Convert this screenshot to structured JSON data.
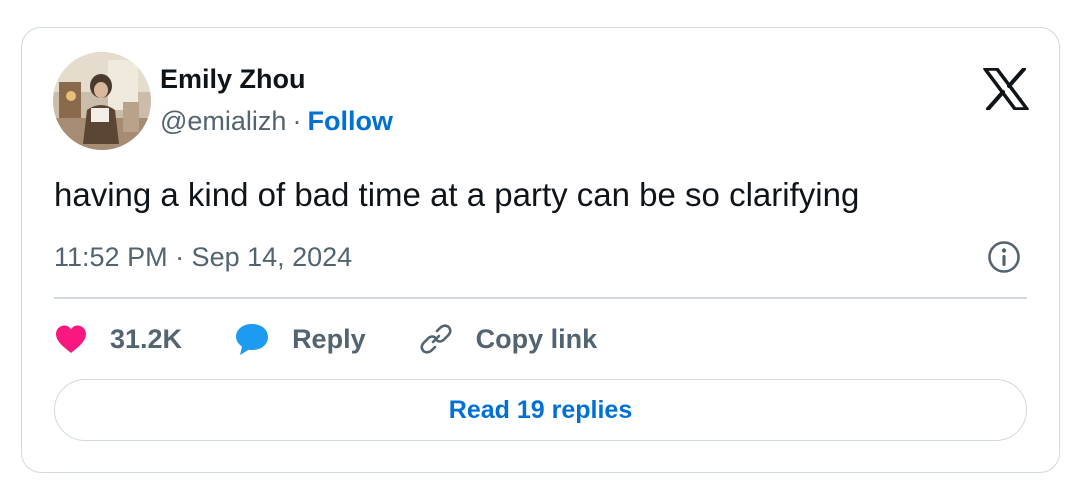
{
  "author": {
    "name": "Emily Zhou",
    "handle": "@emializh",
    "separator": "·",
    "follow_label": "Follow"
  },
  "tweet": {
    "text": "having a kind of bad time at a party can be so clarifying",
    "timestamp": "11:52 PM · Sep 14, 2024"
  },
  "actions": {
    "likes_count": "31.2K",
    "reply_label": "Reply",
    "copy_link_label": "Copy link"
  },
  "read_replies_label": "Read 19 replies",
  "icons": {
    "logo": "x-logo-icon",
    "info": "info-icon",
    "like": "heart-icon",
    "reply": "speech-bubble-icon",
    "copy": "link-icon"
  },
  "colors": {
    "like": "#f91880",
    "reply": "#1d9bf0",
    "link": "#006fd6",
    "secondary_text": "#536471",
    "border": "#cfd9de"
  }
}
